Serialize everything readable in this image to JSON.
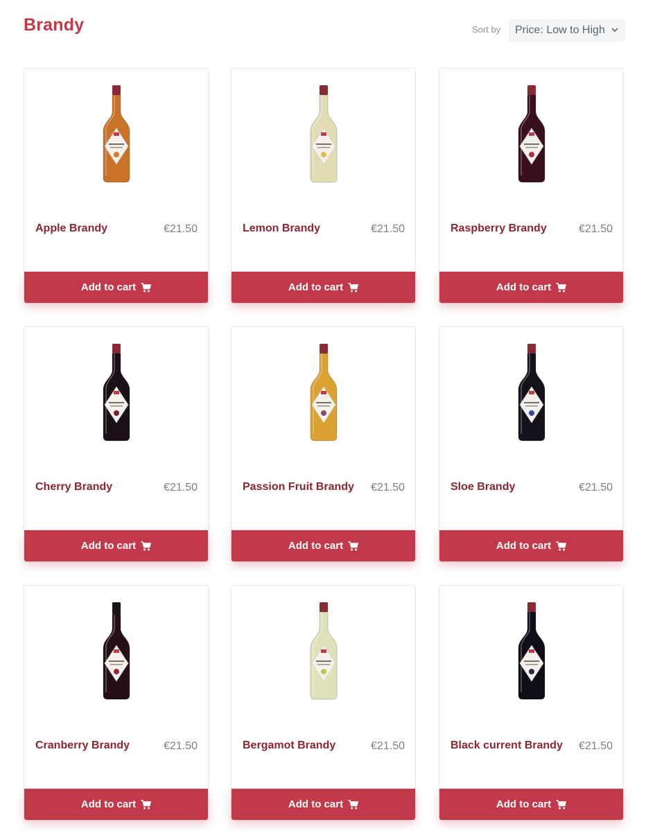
{
  "page": {
    "title": "Brandy"
  },
  "sort": {
    "label": "Sort by",
    "selected": "Price: Low to High"
  },
  "colors": {
    "accent": "#c23a4a",
    "title": "#c23a46",
    "product_name": "#8c2533"
  },
  "products": [
    {
      "name": "Apple Brandy",
      "price": "€21.50",
      "button": "Add to cart",
      "liquid": "#c9732a",
      "label_accent": "#d27a2f"
    },
    {
      "name": "Lemon Brandy",
      "price": "€21.50",
      "button": "Add to cart",
      "liquid": "#e2dcb4",
      "label_accent": "#d8c24a"
    },
    {
      "name": "Raspberry Brandy",
      "price": "€21.50",
      "button": "Add to cart",
      "liquid": "#3a0f1e",
      "label_accent": "#b4303e"
    },
    {
      "name": "Cherry Brandy",
      "price": "€21.50",
      "button": "Add to cart",
      "liquid": "#1c1018",
      "label_accent": "#7a1e2a"
    },
    {
      "name": "Passion Fruit Brandy",
      "price": "€21.50",
      "button": "Add to cart",
      "liquid": "#d9a233",
      "label_accent": "#8a4a6a"
    },
    {
      "name": "Sloe Brandy",
      "price": "€21.50",
      "button": "Add to cart",
      "liquid": "#15121c",
      "label_accent": "#3a4a9a"
    },
    {
      "name": "Cranberry Brandy",
      "price": "€21.50",
      "button": "Add to cart",
      "liquid": "#241016",
      "label_accent": "#9a2232"
    },
    {
      "name": "Bergamot Brandy",
      "price": "€21.50",
      "button": "Add to cart",
      "liquid": "#dfe2b8",
      "label_accent": "#c2c84a"
    },
    {
      "name": "Black current Brandy",
      "price": "€21.50",
      "button": "Add to cart",
      "liquid": "#110d16",
      "label_accent": "#2a2a44"
    }
  ],
  "icons": {
    "cart": "cart-icon",
    "chevron": "chevron-down-icon"
  }
}
